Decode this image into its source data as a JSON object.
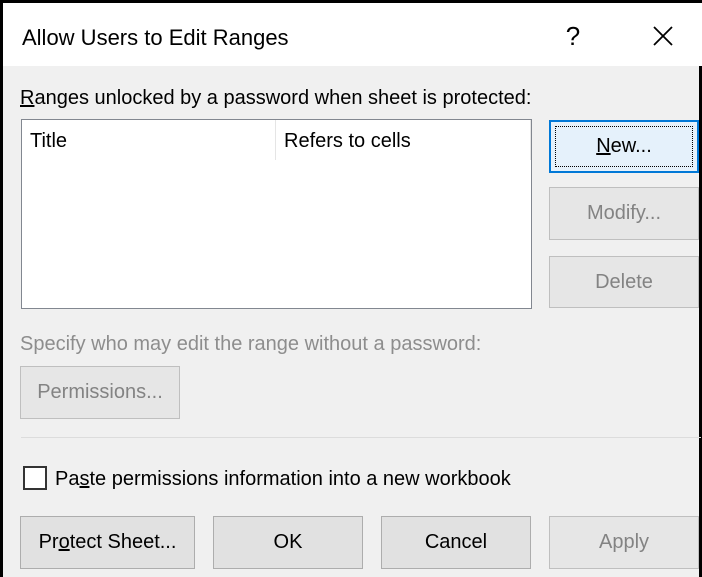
{
  "dialog": {
    "title": "Allow Users to Edit Ranges",
    "help_label": "?",
    "close_label": "✕"
  },
  "ranges": {
    "label_pre": "",
    "label_mnemonic": "R",
    "label_post": "anges unlocked by a password when sheet is protected:",
    "columns": [
      "Title",
      "Refers to cells"
    ],
    "rows": []
  },
  "buttons": {
    "new_mnemonic": "N",
    "new_rest": "ew...",
    "modify": "Modify...",
    "delete": "Delete",
    "permissions": "Permissions...",
    "protect_pre": "Pr",
    "protect_mnemonic": "o",
    "protect_post": "tect Sheet...",
    "ok": "OK",
    "cancel": "Cancel",
    "apply": "Apply"
  },
  "specify": {
    "label": "Specify who may edit the range without a password:"
  },
  "paste": {
    "label_pre": "Pa",
    "label_mnemonic": "s",
    "label_post": "te permissions information into a new workbook",
    "checked": false
  }
}
